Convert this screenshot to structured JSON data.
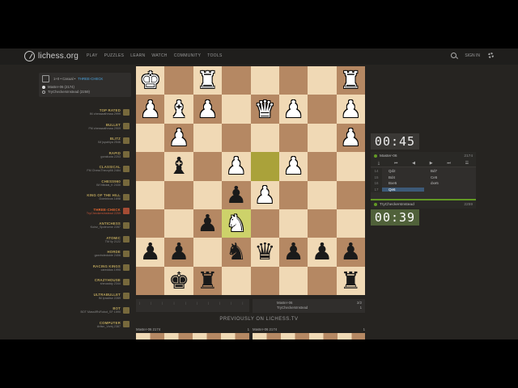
{
  "header": {
    "logo": "lichess.org",
    "nav": [
      "PLAY",
      "PUZZLES",
      "LEARN",
      "WATCH",
      "COMMUNITY",
      "TOOLS"
    ],
    "sign_in": "SIGN IN"
  },
  "game_info": {
    "clock_type": "1+0 • Casual •",
    "variant": "THREE-CHECK",
    "white": "Master-06 (2174)",
    "black": "TryCheckersInstead (2259)"
  },
  "ratings": [
    {
      "name": "TOP RATED",
      "who": "IM chessaathmaa 2999",
      "icon": "trophy-icon"
    },
    {
      "name": "BULLET",
      "who": "FM chessaathmaa 2909",
      "icon": "bullet-icon"
    },
    {
      "name": "BLITZ",
      "who": "IM jspahiya 2546",
      "icon": "blitz-icon"
    },
    {
      "name": "RAPID",
      "who": "gorakuda 2203",
      "icon": "rapid-icon"
    },
    {
      "name": "CLASSICAL",
      "who": "FM ChessTheory66 2484",
      "icon": "classical-icon"
    },
    {
      "name": "CHESS960",
      "who": "IM Nikolai_K 2430",
      "icon": "chess960-icon"
    },
    {
      "name": "KING OF THE HILL",
      "who": "Dominicus 1698",
      "icon": "koth-icon"
    },
    {
      "name": "THREE-CHECK",
      "who": "TryCheckersInstead 2259",
      "icon": "three-check-icon",
      "active": true
    },
    {
      "name": "ANTICHESS",
      "who": "Kuinz_Spotnome 2287",
      "icon": "antichess-icon"
    },
    {
      "name": "ATOMIC",
      "who": "TM Ily 2122",
      "icon": "atomic-icon"
    },
    {
      "name": "HORDE",
      "who": "garvindedoide 2406",
      "icon": "horde-icon"
    },
    {
      "name": "RACING KINGS",
      "who": "careddus 1995",
      "icon": "racing-kings-icon"
    },
    {
      "name": "CRAZYHOUSE",
      "who": "sheuaddy 2344",
      "icon": "crazyhouse-icon"
    },
    {
      "name": "ULTRABULLET",
      "who": "IM ipradise 2289",
      "icon": "ultrabullet-icon"
    },
    {
      "name": "BOT",
      "who": "BOT MassIlRvRobot_SF 1590",
      "icon": "bot-icon"
    },
    {
      "name": "COMPUTER",
      "who": "Artisn_Vorbj 2387",
      "icon": "computer-icon"
    }
  ],
  "board": {
    "rows": [
      [
        "wK",
        "",
        "wR",
        "",
        "",
        "",
        "",
        "wR"
      ],
      [
        "wP",
        "wB",
        "wP",
        "",
        "wQ",
        "wP",
        "",
        "wP"
      ],
      [
        "",
        "wP",
        "",
        "",
        "",
        "",
        "",
        "wP"
      ],
      [
        "",
        "bB",
        "",
        "wP",
        "",
        "wP",
        "",
        ""
      ],
      [
        "",
        "",
        "",
        "bP",
        "wP",
        "",
        "",
        ""
      ],
      [
        "",
        "",
        "bP",
        "wN",
        "",
        "",
        "",
        ""
      ],
      [
        "bP",
        "bP",
        "",
        "bN",
        "bQ",
        "bP",
        "bP",
        "bP"
      ],
      [
        "",
        "bK",
        "bR",
        "",
        "",
        "",
        "",
        "bR"
      ]
    ],
    "highlights": [
      "d3",
      "e5"
    ]
  },
  "clocks": {
    "top": "00:45",
    "bottom": "00:39"
  },
  "players": {
    "top_name": "Master-06",
    "top_rating": "2174",
    "bottom_name": "TryCheckersInstead",
    "bottom_rating": "2259"
  },
  "controls": [
    "⤓",
    "⏮",
    "◀",
    "▶",
    "⏭",
    "☰"
  ],
  "moves": [
    {
      "no": "14",
      "w": "Qd2",
      "b": "Bd7"
    },
    {
      "no": "15",
      "w": "Bd4",
      "b": "Ce5"
    },
    {
      "no": "16",
      "w": "Bxe5",
      "b": "dxe5"
    },
    {
      "no": "17",
      "w": "Qe6",
      "b": "",
      "current": "w"
    }
  ],
  "mini_game": {
    "white": "Master-06",
    "white_score": "2/2",
    "black": "TryCheckersInstead",
    "black_score": "1"
  },
  "previously": "PREVIOUSLY ON LICHESS.TV",
  "tv": [
    {
      "player": "Master-06",
      "rating": "2174",
      "score": "1"
    },
    {
      "player": "Master-06",
      "rating": "2174",
      "score": "1"
    }
  ]
}
